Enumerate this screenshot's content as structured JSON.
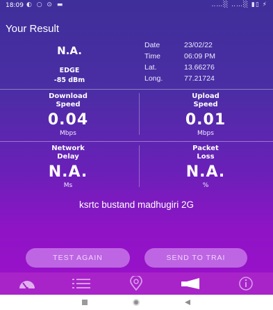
{
  "status_bar": {
    "time": "18:09",
    "left_icons": "◐ ○ ⊙ ▬",
    "right_icons": "‥…░ ‥…░ ▮▯ ⚡"
  },
  "header": {
    "title": "Your Result"
  },
  "network": {
    "name": "N.A.",
    "type": "EDGE",
    "signal": "-85 dBm"
  },
  "meta": [
    {
      "label": "Date",
      "value": "23/02/22"
    },
    {
      "label": "Time",
      "value": "06:09 PM"
    },
    {
      "label": "Lat.",
      "value": "13.66276"
    },
    {
      "label": "Long.",
      "value": "77.21724"
    }
  ],
  "metrics": {
    "download": {
      "label_line1": "Download",
      "label_line2": "Speed",
      "value": "0.04",
      "unit": "Mbps"
    },
    "upload": {
      "label_line1": "Upload",
      "label_line2": "Speed",
      "value": "0.01",
      "unit": "Mbps"
    },
    "delay": {
      "label_line1": "Network",
      "label_line2": "Delay",
      "value": "N.A.",
      "unit": "Ms"
    },
    "loss": {
      "label_line1": "Packet",
      "label_line2": "Loss",
      "value": "N.A.",
      "unit": "%"
    }
  },
  "location": "ksrtc bustand madhugiri 2G",
  "buttons": {
    "test_again": "TEST AGAIN",
    "send_to_trai": "SEND TO TRAI"
  },
  "tab_bar": {
    "tabs": [
      {
        "icon": "speedometer-icon"
      },
      {
        "icon": "list-icon"
      },
      {
        "icon": "map-pin-icon"
      },
      {
        "icon": "megaphone-icon",
        "active": true
      },
      {
        "icon": "info-icon"
      }
    ]
  },
  "colors": {
    "gradient_top": "#3f2f9a",
    "gradient_bottom": "#9c10c9",
    "button": "#be65e3",
    "tab_bar": "#a824c8"
  }
}
